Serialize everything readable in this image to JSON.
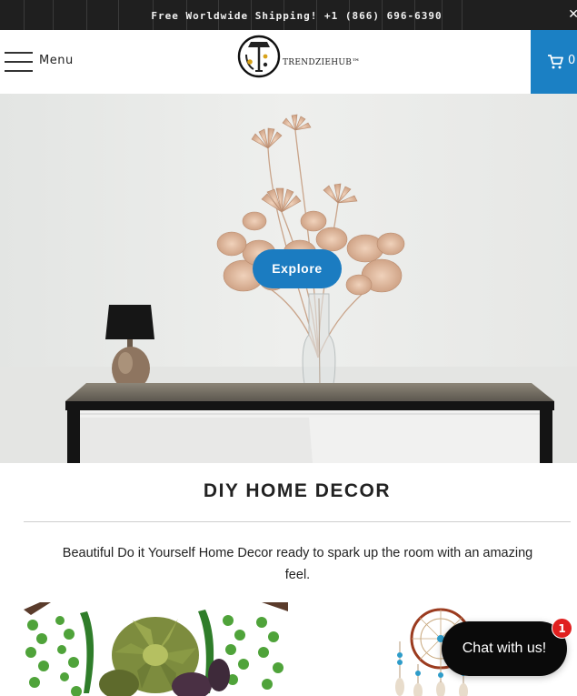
{
  "announcement": {
    "text": "Free Worldwide Shipping! +1 (866) 696-6390",
    "close_icon": "close-icon"
  },
  "header": {
    "menu_label": "Menu",
    "menu_icon": "hamburger-icon",
    "logo_text": "TRENDZIEHUB™",
    "cart_icon": "cart-icon",
    "cart_count": "0"
  },
  "hero": {
    "explore_label": "Explore"
  },
  "section": {
    "title": "DIY HOME DECOR",
    "description": "Beautiful Do it Yourself Home Decor ready to spark up the room with an amazing feel."
  },
  "chat": {
    "label": "Chat with us!",
    "badge": "1"
  },
  "colors": {
    "accent": "#1b80c4",
    "announcement_bg": "#1f1f1f",
    "chat_bg": "#0a0a0a",
    "badge": "#e0201f"
  }
}
